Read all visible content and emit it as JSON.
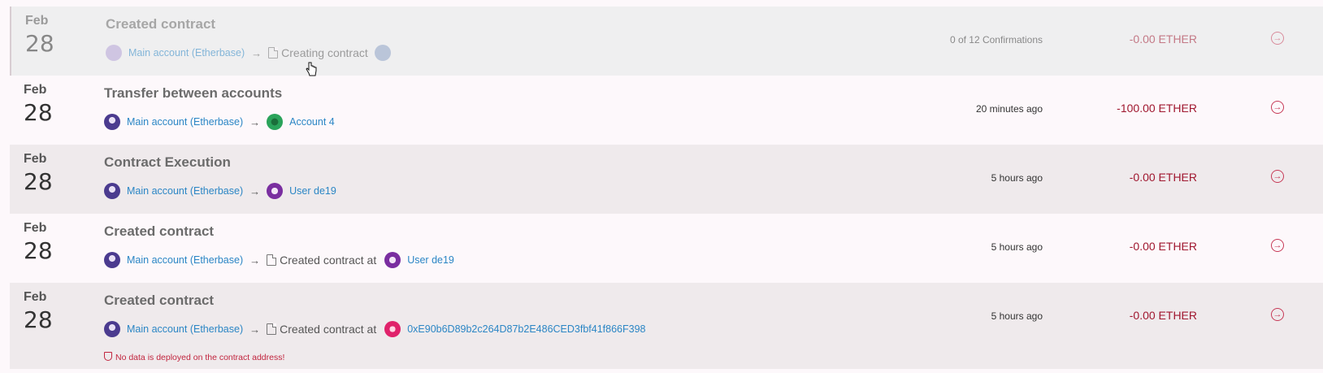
{
  "colors": {
    "link": "#2b86c5",
    "amount": "#a0172f",
    "accent": "#c73a57",
    "shaded_row": "#efeaec"
  },
  "transactions": [
    {
      "month": "Feb",
      "day": "28",
      "title": "Created contract",
      "from": "Main account (Etherbase)",
      "target": "Creating contract",
      "time": "0 of 12 Confirmations",
      "amount": "-0.00 ETHER",
      "state": "pending"
    },
    {
      "month": "Feb",
      "day": "28",
      "title": "Transfer between accounts",
      "from": "Main account (Etherbase)",
      "to": "Account 4",
      "time": "20 minutes ago",
      "amount": "-100.00 ETHER"
    },
    {
      "month": "Feb",
      "day": "28",
      "title": "Contract Execution",
      "from": "Main account (Etherbase)",
      "to": "User de19",
      "time": "5 hours ago",
      "amount": "-0.00 ETHER"
    },
    {
      "month": "Feb",
      "day": "28",
      "title": "Created contract",
      "from": "Main account (Etherbase)",
      "target": "Created contract at",
      "to": "User de19",
      "time": "5 hours ago",
      "amount": "-0.00 ETHER"
    },
    {
      "month": "Feb",
      "day": "28",
      "title": "Created contract",
      "from": "Main account (Etherbase)",
      "target": "Created contract at",
      "to": "0xE90b6D89b2c264D87b2E486CED3fbf41f866F398",
      "time": "5 hours ago",
      "amount": "-0.00 ETHER",
      "warning": "No data is deployed on the contract address!"
    }
  ],
  "icons": {
    "arrow": "→",
    "open": "open-transaction-icon"
  }
}
